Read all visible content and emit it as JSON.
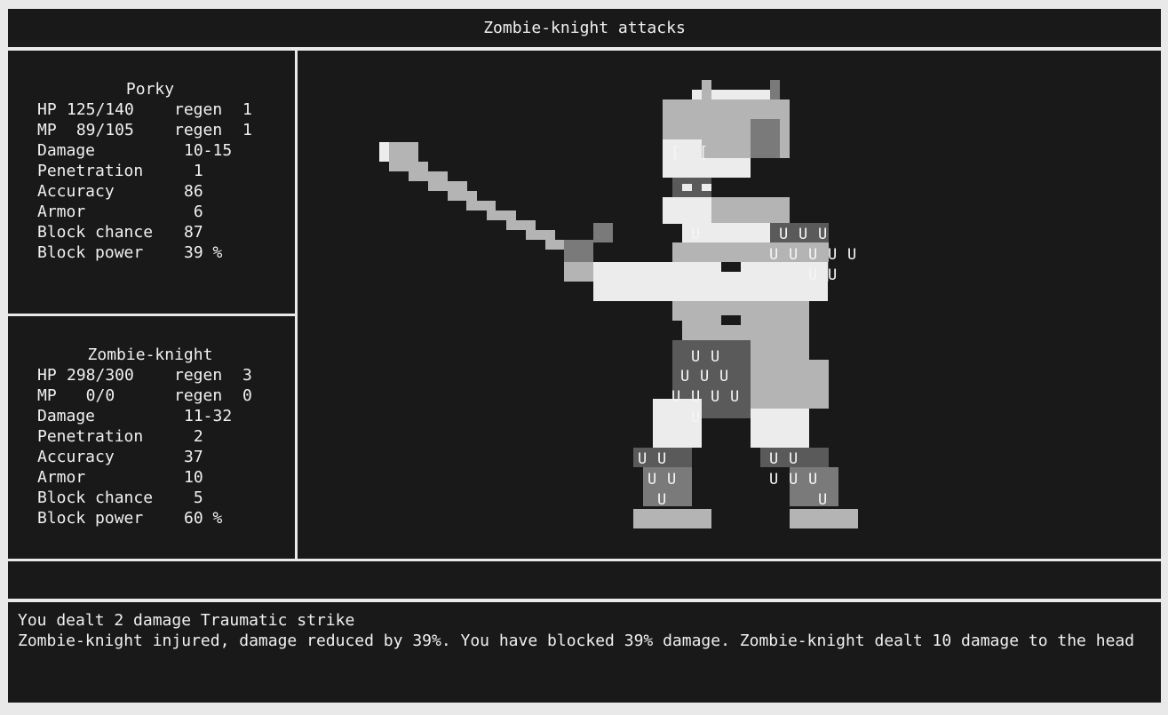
{
  "header": {
    "title": "Zombie-knight attacks"
  },
  "player": {
    "name": "Porky",
    "rows": [
      {
        "label": "HP",
        "value": "125/140",
        "regen_label": "regen",
        "regen_value": "1"
      },
      {
        "label": "MP",
        "value": " 89/105",
        "regen_label": "regen",
        "regen_value": "1"
      },
      {
        "label": "Damage",
        "value": "10-15"
      },
      {
        "label": "Penetration",
        "value": " 1"
      },
      {
        "label": "Accuracy",
        "value": "86"
      },
      {
        "label": "Armor",
        "value": " 6"
      },
      {
        "label": "Block chance",
        "value": "87"
      },
      {
        "label": "Block power",
        "value": "39 %"
      }
    ]
  },
  "enemy": {
    "name": "Zombie-knight",
    "rows": [
      {
        "label": "HP",
        "value": "298/300",
        "regen_label": "regen",
        "regen_value": "3"
      },
      {
        "label": "MP",
        "value": "  0/0",
        "regen_label": "regen",
        "regen_value": "0"
      },
      {
        "label": "Damage",
        "value": "11-32"
      },
      {
        "label": "Penetration",
        "value": " 2"
      },
      {
        "label": "Accuracy",
        "value": "37"
      },
      {
        "label": "Armor",
        "value": "10"
      },
      {
        "label": "Block chance",
        "value": " 5"
      },
      {
        "label": "Block power",
        "value": "60 %"
      }
    ]
  },
  "sprite": {
    "description_icon": "zombie-knight-sprite",
    "eye_glyph": "[",
    "mail_glyph": "U",
    "colors": {
      "light": "#ececec",
      "mid": "#b4b4b4",
      "dark": "#7a7a7a",
      "shadow": "#5a5a5a",
      "bg": "#191919"
    }
  },
  "status": {
    "text": ""
  },
  "log": {
    "lines": [
      "You dealt 2 damage Traumatic strike",
      "Zombie-knight injured, damage reduced by 39%. You have blocked 39% damage. Zombie-knight dealt 10 damage to the head"
    ]
  },
  "colors": {
    "panel_bg": "#191919",
    "frame": "#e9e9e9",
    "text": "#f0f0f0"
  }
}
